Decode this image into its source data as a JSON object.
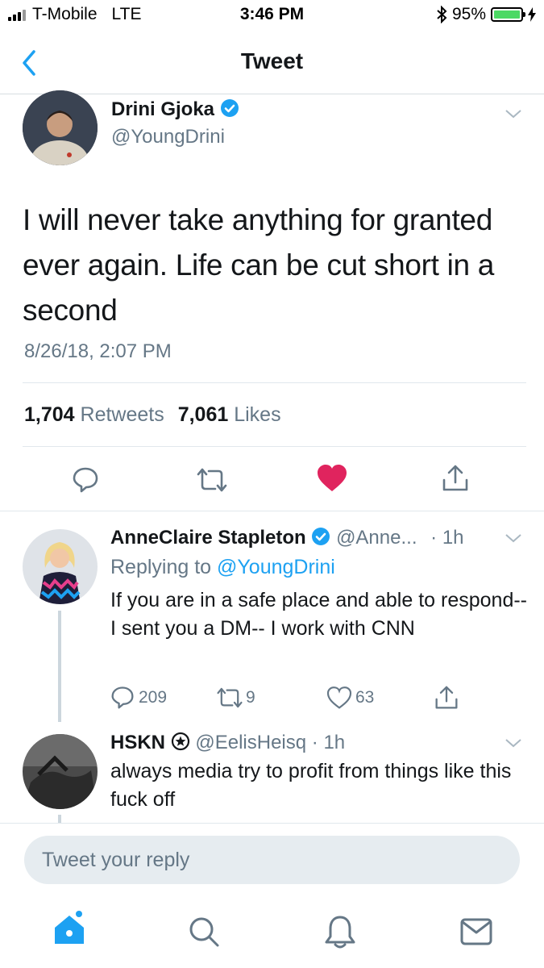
{
  "status": {
    "carrier": "T-Mobile",
    "network": "LTE",
    "time": "3:46 PM",
    "battery": "95%",
    "battery_level": 0.95
  },
  "nav": {
    "title": "Tweet"
  },
  "tweet": {
    "name": "Drini Gjoka",
    "handle": "@YoungDrini",
    "text": "I will never take anything for granted ever again. Life can be cut short in a second",
    "timestamp": "8/26/18, 2:07 PM",
    "retweets": "1,704",
    "retweets_label": "Retweets",
    "likes": "7,061",
    "likes_label": "Likes",
    "liked": true
  },
  "replies": [
    {
      "name": "AnneClaire Stapleton",
      "handle": "@Anne...",
      "time": "· 1h",
      "replying_prefix": "Replying to",
      "replying_to": "@YoungDrini",
      "text": "If you are in a safe place and able to respond-- I sent you a DM-- I work with CNN",
      "reply_count": "209",
      "retweet_count": "9",
      "like_count": "63"
    },
    {
      "name": "HSKN",
      "handle": "@EelisHeisq",
      "time": "· 1h",
      "text": "always media try to profit from things like this fuck off"
    }
  ],
  "compose": {
    "placeholder": "Tweet your reply"
  },
  "tabbar": [
    "home-icon",
    "search-icon",
    "notifications-icon",
    "messages-icon"
  ],
  "colors": {
    "accent": "#1da1f2",
    "like": "#e0245e",
    "muted": "#657786"
  }
}
